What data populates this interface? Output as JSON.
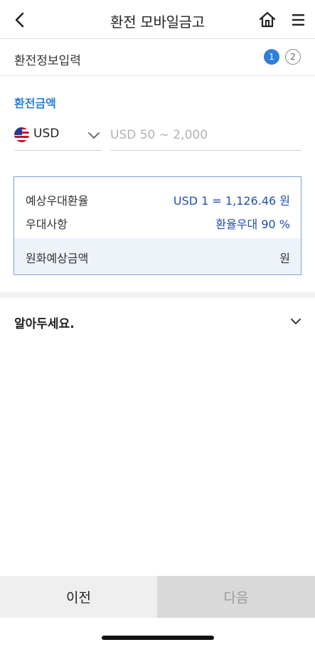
{
  "header": {
    "title": "환전 모바일금고",
    "back_icon": "chevron-left-icon",
    "home_icon": "home-icon",
    "menu_icon": "hamburger-menu-icon"
  },
  "steps": {
    "label": "환전정보입력",
    "items": [
      "1",
      "2"
    ],
    "active_color": "#2f7fd8"
  },
  "exchange": {
    "section_title": "환전금액",
    "currency": "USD",
    "flag_icon": "us-flag-icon",
    "amount_placeholder": "USD 50 ~ 2,000",
    "amount_value": ""
  },
  "rate_box": {
    "expected_rate_label": "예상우대환율",
    "expected_rate_value": "USD 1 = 1,126.46",
    "expected_rate_unit": "원",
    "preferential_label": "우대사항",
    "preferential_value": "환율우대 90 %",
    "krw_label": "원화예상금액",
    "krw_value": "",
    "krw_unit": "원",
    "accent_color": "#1f4fb0"
  },
  "notice": {
    "label": "알아두세요."
  },
  "footer": {
    "prev_label": "이전",
    "next_label": "다음"
  }
}
